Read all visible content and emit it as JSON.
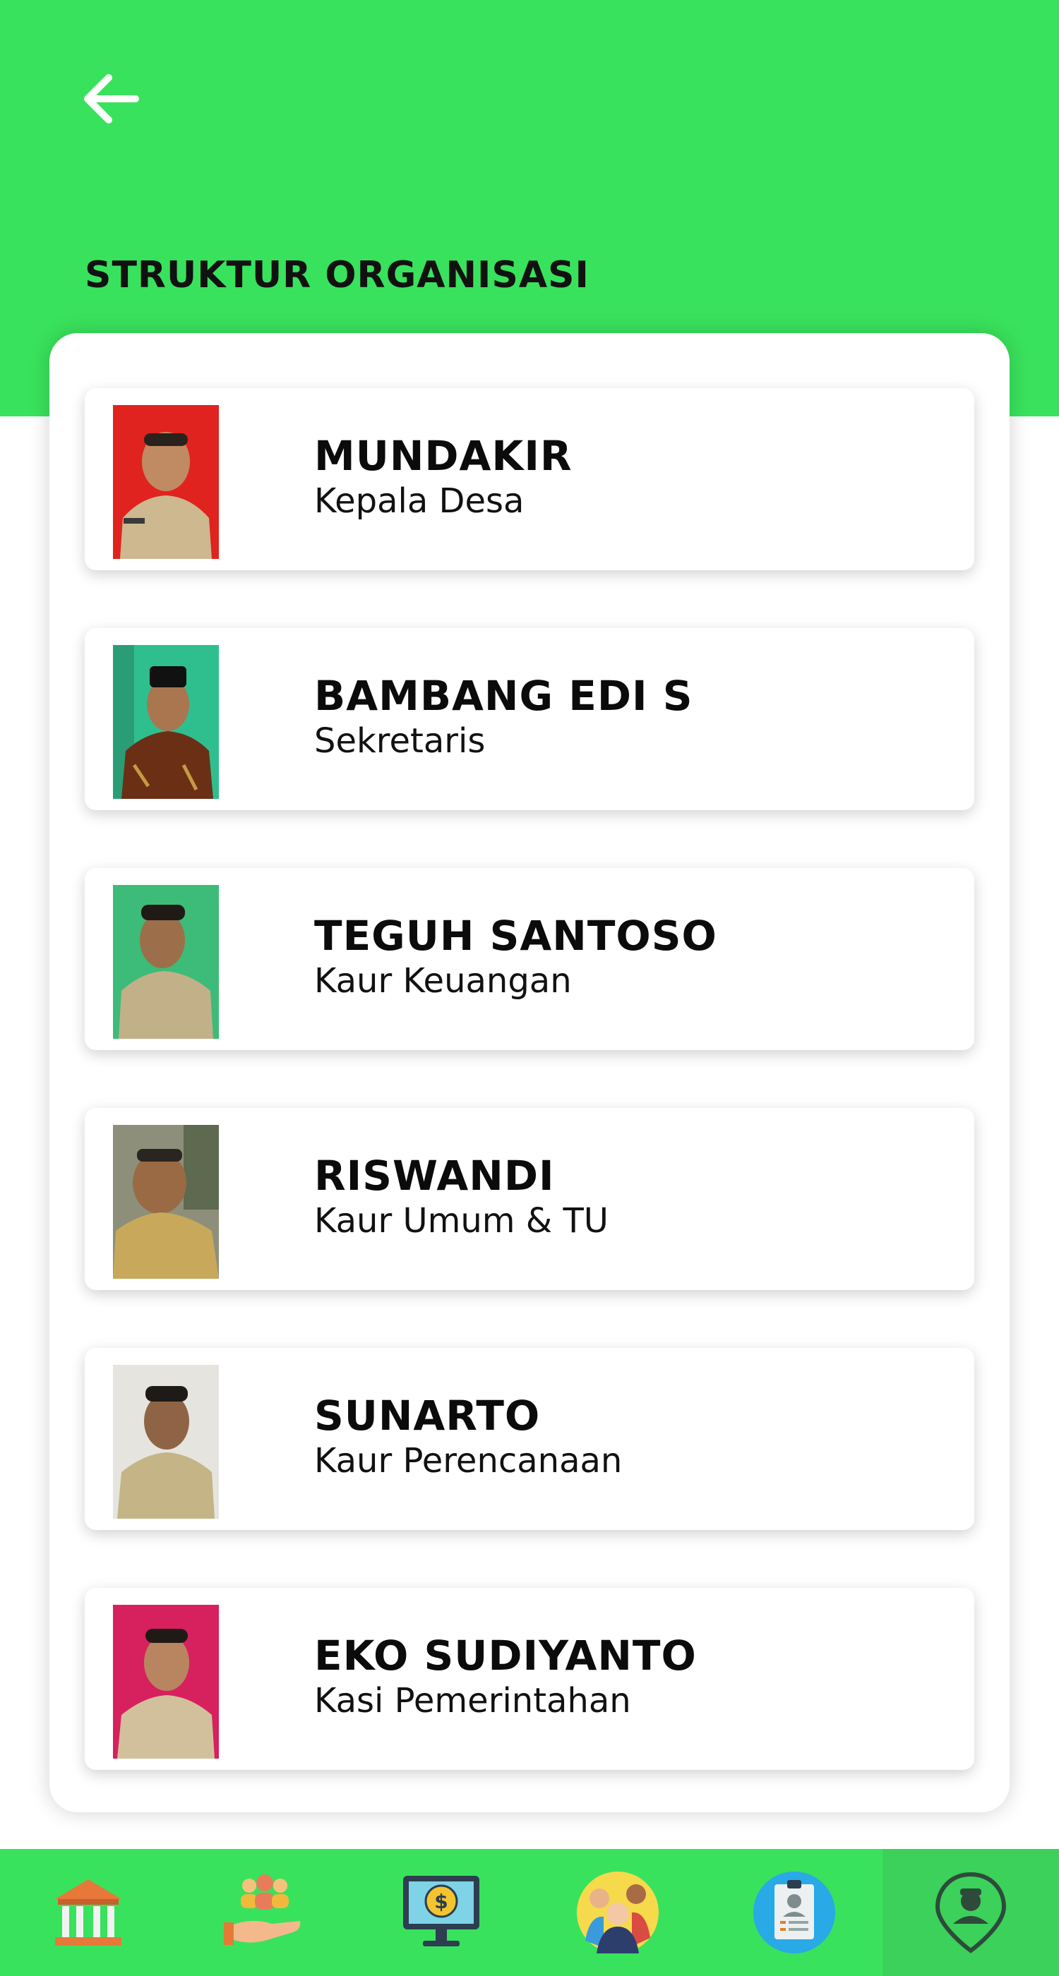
{
  "header": {
    "title": "STRUKTUR ORGANISASI"
  },
  "members": [
    {
      "name": "MUNDAKIR",
      "role": "Kepala Desa"
    },
    {
      "name": "BAMBANG EDI S",
      "role": "Sekretaris"
    },
    {
      "name": "TEGUH SANTOSO",
      "role": "Kaur Keuangan"
    },
    {
      "name": "RISWANDI",
      "role": "Kaur Umum & TU"
    },
    {
      "name": "SUNARTO",
      "role": "Kaur Perencanaan"
    },
    {
      "name": "EKO SUDIYANTO",
      "role": "Kasi Pemerintahan"
    }
  ],
  "bottom_nav": {
    "items": [
      {
        "icon": "bank-building-icon"
      },
      {
        "icon": "people-hand-icon"
      },
      {
        "icon": "monitor-money-icon"
      },
      {
        "icon": "group-people-icon"
      },
      {
        "icon": "id-card-icon"
      },
      {
        "icon": "location-person-icon",
        "active": true
      }
    ]
  },
  "colors": {
    "primary_green": "#39e25c",
    "active_nav": "#3bd15a"
  }
}
